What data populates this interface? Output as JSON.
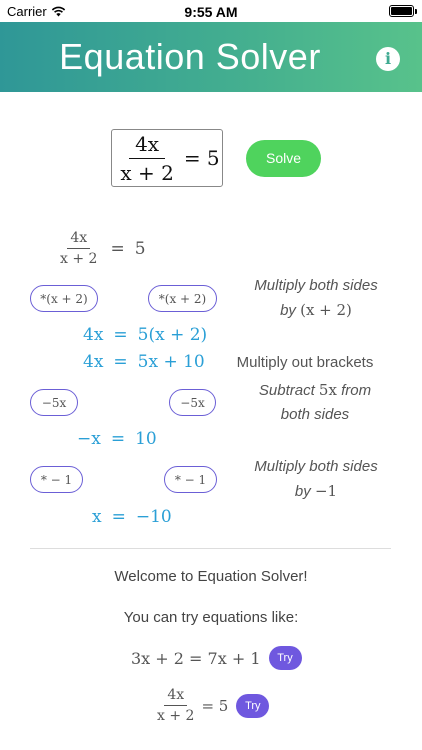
{
  "status_bar": {
    "carrier": "Carrier",
    "time": "9:55 AM"
  },
  "header": {
    "title": "Equation Solver",
    "info_icon": "i"
  },
  "input": {
    "numerator": "4x",
    "denominator": "x + 2",
    "rhs": "= 5",
    "solve_label": "Solve"
  },
  "steps": {
    "original": {
      "num": "4x",
      "den": "x + 2",
      "eq": "=",
      "rhs": "5"
    },
    "step1": {
      "pill_left": "*(x + 2)",
      "pill_right": "*(x + 2)",
      "note_line1": "Multiply both sides",
      "note_line2_prefix": "by",
      "note_line2_math": "(x + 2)"
    },
    "line1": {
      "lhs": "4x",
      "eq": "=",
      "rhs": "5(x + 2)"
    },
    "line2": {
      "lhs": "4x",
      "eq": "=",
      "rhs": "5x + 10"
    },
    "step2": {
      "note": "Multiply out brackets"
    },
    "step3": {
      "pill_left": "−5x",
      "pill_right": "−5x",
      "note_line1_prefix": "Subtract",
      "note_line1_math": "5x",
      "note_line1_suffix": "from",
      "note_line2": "both sides"
    },
    "line3": {
      "lhs": "−x",
      "eq": "=",
      "rhs": "10"
    },
    "step4": {
      "pill_left": "* − 1",
      "pill_right": "* − 1",
      "note_line1": "Multiply both sides",
      "note_line2_prefix": "by",
      "note_line2_math": "−1"
    },
    "line4": {
      "lhs": "x",
      "eq": "=",
      "rhs": "−10"
    }
  },
  "welcome": {
    "title": "Welcome to Equation Solver!",
    "try_text": "You can try equations like:",
    "examples": [
      {
        "equation": "3x + 2 = 7x + 1",
        "button": "Try"
      },
      {
        "num": "4x",
        "den": "x + 2",
        "rhs": "= 5",
        "button": "Try"
      }
    ]
  },
  "colors": {
    "header_start": "#2f9797",
    "header_end": "#58c28b",
    "solve": "#4fd35d",
    "pill_border": "#6b5fd6",
    "try": "#6f58df",
    "result_blue": "#2a9fd6"
  }
}
